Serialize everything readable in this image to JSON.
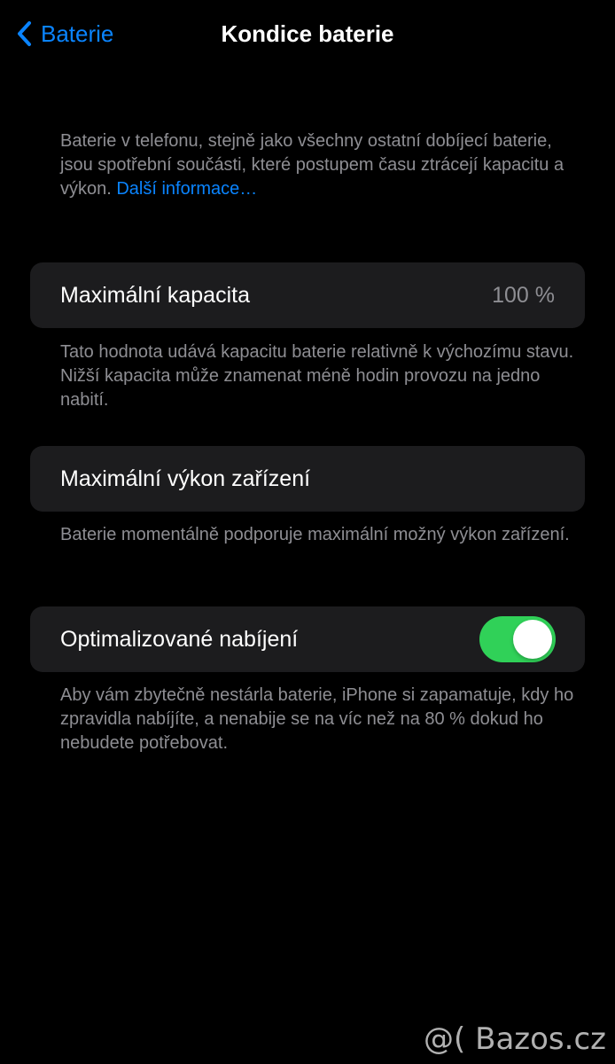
{
  "nav": {
    "back_label": "Baterie",
    "title": "Kondice baterie"
  },
  "intro": {
    "text": "Baterie v telefonu, stejně jako všechny ostatní dobíjecí baterie, jsou spotřební součásti, které postupem času ztrácejí kapacitu a výkon. ",
    "link": "Další informace…"
  },
  "capacity": {
    "label": "Maximální kapacita",
    "value": "100 %",
    "footer": "Tato hodnota udává kapacitu baterie relativně k výchozímu stavu. Nižší kapacita může znamenat méně hodin provozu na jedno nabití."
  },
  "performance": {
    "label": "Maximální výkon zařízení",
    "footer": "Baterie momentálně podporuje maximální možný výkon zařízení."
  },
  "optimized": {
    "label": "Optimalizované nabíjení",
    "enabled": true,
    "footer": "Aby vám zbytečně nestárla baterie, iPhone si zapamatuje, kdy ho zpravidla nabíjíte, a nenabije se na víc než na 80 % dokud ho nebudete potřebovat."
  },
  "watermark": "@( Bazos.cz",
  "colors": {
    "background": "#000000",
    "card": "#1c1c1e",
    "accent": "#0a84ff",
    "toggle_on": "#30d158",
    "secondary_text": "#8e8e93"
  },
  "icons": {
    "back": "chevron-left-icon"
  }
}
